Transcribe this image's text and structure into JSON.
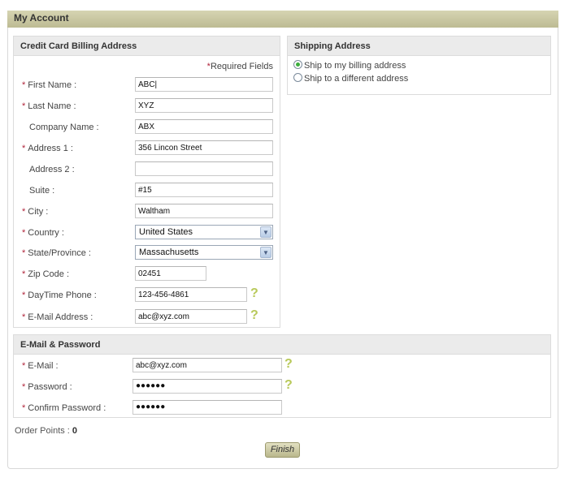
{
  "header": {
    "title": "My Account"
  },
  "billing": {
    "title": "Credit Card Billing Address",
    "required_star": "*",
    "required_note": "Required Fields",
    "fields": [
      {
        "label": "First Name :",
        "required": true,
        "value": "ABC|"
      },
      {
        "label": "Last Name :",
        "required": true,
        "value": "XYZ"
      },
      {
        "label": "Company Name :",
        "required": false,
        "value": "ABX"
      },
      {
        "label": "Address 1 :",
        "required": true,
        "value": "356 Lincon Street"
      },
      {
        "label": "Address 2 :",
        "required": false,
        "value": ""
      },
      {
        "label": "Suite :",
        "required": false,
        "value": "#15"
      },
      {
        "label": "City :",
        "required": true,
        "value": "Waltham"
      },
      {
        "label": "Country :",
        "required": true,
        "value": "United States"
      },
      {
        "label": "State/Province :",
        "required": true,
        "value": "Massachusetts"
      },
      {
        "label": "Zip Code :",
        "required": true,
        "value": "02451"
      },
      {
        "label": "DayTime Phone :",
        "required": true,
        "value": "123-456-4861"
      },
      {
        "label": "E-Mail Address :",
        "required": true,
        "value": "abc@xyz.com"
      }
    ]
  },
  "shipping": {
    "title": "Shipping Address",
    "options": [
      {
        "label": "Ship to my billing address",
        "selected": true
      },
      {
        "label": "Ship to a different address",
        "selected": false
      }
    ]
  },
  "email_password": {
    "title": "E-Mail & Password",
    "fields": [
      {
        "label": "E-Mail :",
        "required": true,
        "value": "abc@xyz.com"
      },
      {
        "label": "Password :",
        "required": true,
        "value": "●●●●●●"
      },
      {
        "label": "Confirm Password :",
        "required": true,
        "value": "●●●●●●"
      }
    ]
  },
  "help_icon": "?",
  "dropdown_arrow": "▼",
  "order_points": {
    "label": "Order Points :",
    "value": "0"
  },
  "finish_button": "Finish"
}
